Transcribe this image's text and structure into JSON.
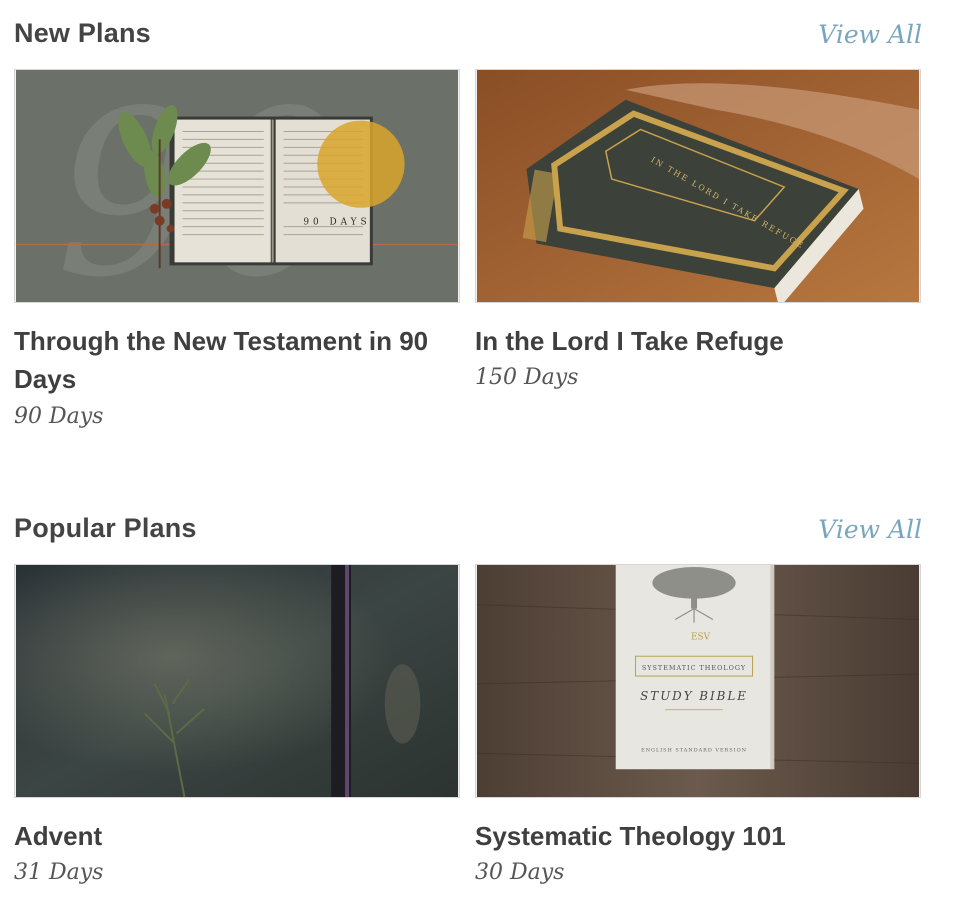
{
  "sections": [
    {
      "title": "New Plans",
      "view_all": "View All",
      "plans": [
        {
          "title": "Through the New Testament in 90 Days",
          "days": "90 Days",
          "image_text": "90 DAYS"
        },
        {
          "title": "In the Lord I Take Refuge",
          "days": "150 Days",
          "image_text": "IN THE LORD I TAKE REFUGE"
        }
      ]
    },
    {
      "title": "Popular Plans",
      "view_all": "View All",
      "plans": [
        {
          "title": "Advent",
          "days": "31 Days"
        },
        {
          "title": "Systematic Theology 101",
          "days": "30 Days",
          "image_text_1": "SYSTEMATIC THEOLOGY",
          "image_text_2": "STUDY BIBLE",
          "image_text_3": "ENGLISH STANDARD VERSION"
        }
      ]
    }
  ],
  "colors": {
    "accent_link": "#7aa6bd",
    "heading": "#444444",
    "muted": "#555555"
  }
}
